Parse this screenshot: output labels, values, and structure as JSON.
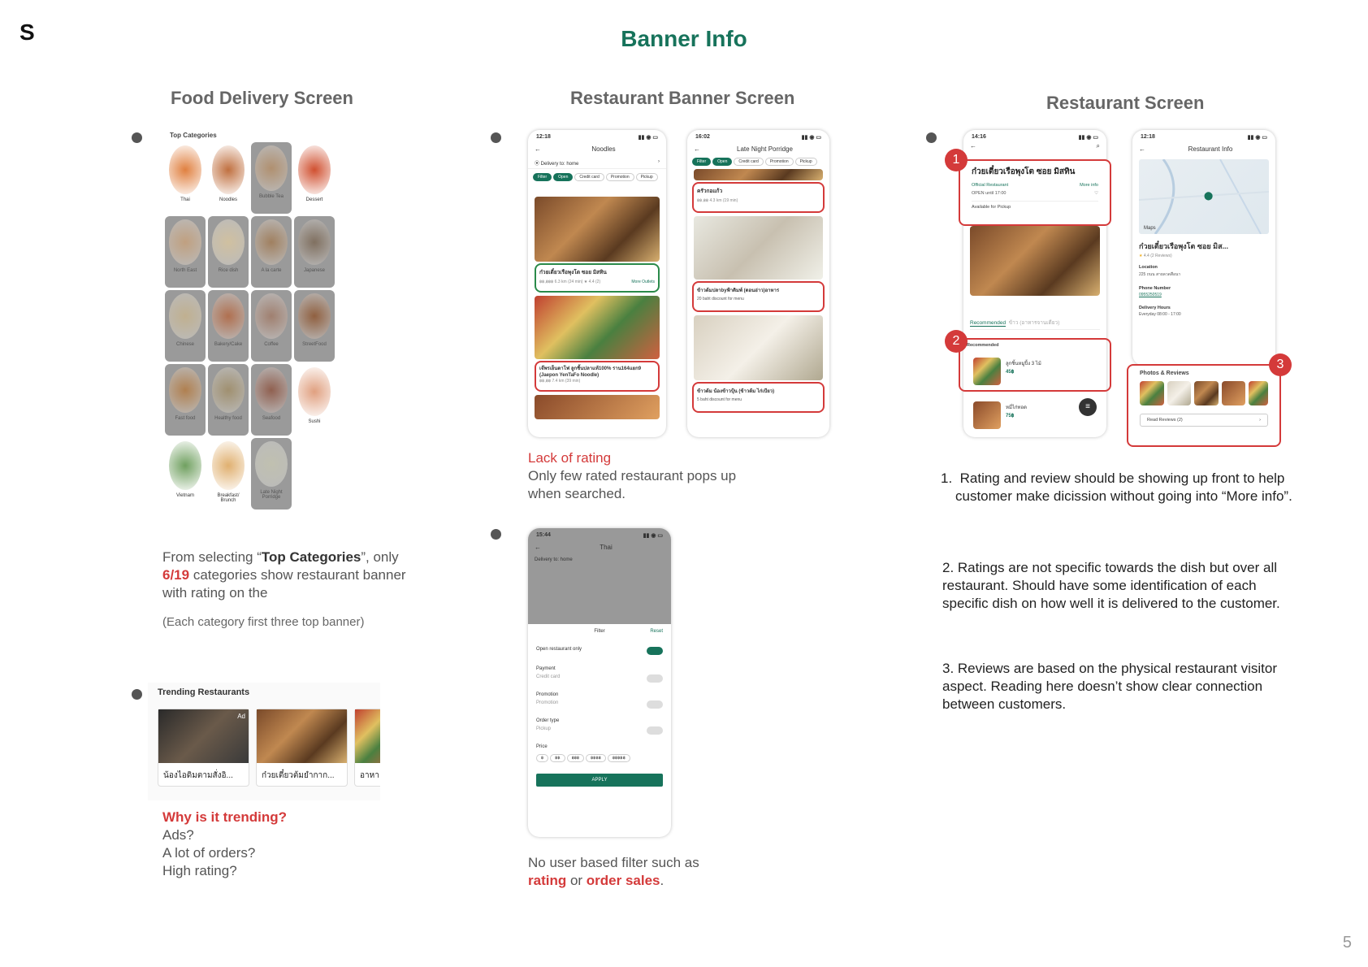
{
  "logo": "S",
  "title": "Banner Info",
  "page_number": "5",
  "sections": {
    "food_delivery": "Food Delivery Screen",
    "restaurant_banner": "Restaurant Banner Screen",
    "restaurant": "Restaurant Screen"
  },
  "top_categories": {
    "heading": "Top Categories",
    "items": [
      "Thai",
      "Noodles",
      "Bubble Tea",
      "Dessert",
      "North East",
      "Rice dish",
      "A la carte",
      "Japanese",
      "Chinese",
      "Bakery/Cake",
      "Coffee",
      "StreetFood",
      "Fast food",
      "Healthy food",
      "Seafood",
      "Sushi",
      "Vietnam",
      "Breakfast/\nBrunch",
      "Late Night\nPorridge"
    ]
  },
  "food_note": {
    "p1_a": "From selecting “",
    "p1_b": "Top Categories",
    "p1_c": "”, only",
    "p1_d": "6/19",
    "p1_e": " categories show restaurant banner with rating on the",
    "p2": "(Each category first three top banner)"
  },
  "trending": {
    "heading": "Trending Restaurants",
    "cards": [
      "น้องไอดิมตามสั่งอิ...",
      "ก๋วยเตี๋ยวต้มยำกาก...",
      "อาหา"
    ],
    "ad": "Ad"
  },
  "trending_note": {
    "q": "Why is it trending?",
    "l1": "Ads?",
    "l2": "A lot of orders?",
    "l3": "High rating?"
  },
  "noodles_phone": {
    "time": "12:18",
    "title": "Noodles",
    "delivery": "Delivery to: home",
    "filters": [
      "Filter",
      "Open",
      "Credit card",
      "Promotion",
      "Pickup"
    ],
    "r1": "ก๋วยเตี๋ยวเรือพุงโต ซอย มิสทิน",
    "r1_meta": "฿฿,฿฿฿  6.3 km (24 min)  ★ 4.4 (2)",
    "r1_more": "More Outlets",
    "r2": "เจ๊พรเย็นตาโฟ ลูกชิ้นปลาแท้100% ราน164แยก9 (Jaepon YenTaFo Noodle)",
    "r2_meta": "฿฿,฿฿  7.4 km (39 min)"
  },
  "porridge_phone": {
    "time": "16:02",
    "title": "Late Night Porridge",
    "r1": "ครัวกอแก้ว",
    "r1_meta": "฿฿,฿฿  4.3 km (19 min)",
    "r2": "ข้าวต้มปลาbyฟ้าดิมพ์ (ดอนอ่าว)อาหาร",
    "r2_promo": "20 baht discount for menu",
    "r3": "ข้าวต้ม น้องข้าวปุ้น (ข้าวต้ม ไก่เบียว)",
    "r3_promo": "5 baht discount for menu"
  },
  "banner_note": {
    "h": "Lack of rating",
    "t": "Only few rated restaurant pops up when searched."
  },
  "thai_phone": {
    "time": "15:44",
    "title": "Thai",
    "delivery": "Delivery to: home",
    "filter": "Filter",
    "reset": "Reset",
    "open_only": "Open restaurant only",
    "payment": "Payment",
    "credit": "Credit card",
    "promotion": "Promotion",
    "promo_opt": "Promotion",
    "order_type": "Order type",
    "pickup": "Pickup",
    "price": "Price",
    "prices": [
      "฿",
      "฿฿",
      "฿฿฿",
      "฿฿฿฿",
      "฿฿฿฿฿"
    ],
    "apply": "APPLY"
  },
  "filter_note": {
    "a": "No user based filter such as ",
    "b": "rating",
    "c": " or ",
    "d": "order sales",
    "e": "."
  },
  "rest_phone": {
    "time": "14:16",
    "name": "ก๋วยเตี๋ยวเรือพุงโต ซอย มิสทิน",
    "official": "Official Restaurant",
    "more": "More info",
    "open": "OPEN until 17:00",
    "pickup": "Available for Pickup",
    "tab1": "Recommended",
    "tab2": "ข้าว (อาหารจานเดียว)",
    "rec": "Recommended",
    "d1": "ลูกชิ้นหมูปิ้ง 3 ไม้",
    "p1": "45฿",
    "d2": "หมี่ไก่ทอด",
    "p2": "75฿"
  },
  "info_phone": {
    "time": "12:18",
    "title": "Restaurant Info",
    "maps": "Maps",
    "name": "ก๋วยเตี๋ยวเรือพุงโต ซอย มิส...",
    "rating": "4.4 (2 Reviews)",
    "loc_h": "Location",
    "loc": "225 ถนน สายลวดสือนา",
    "phone_h": "Phone Number",
    "phone": "0955250519",
    "hours_h": "Delivery Hours",
    "hours": "Everyday  08:00 - 17:00",
    "photos": "Photos & Reviews",
    "read": "Read Reviews (2)"
  },
  "points": [
    "Rating and review should be showing up front to help customer make dicission without going into “More info”.",
    "2.  Ratings are not specific towards the dish but over all restaurant. Should have some identification of each specific dish on how well it is delivered to the customer.",
    "3.  Reviews are based on the physical restaurant visitor aspect. Reading here doesn’t show clear connection between customers."
  ],
  "markers": [
    "1",
    "2",
    "3"
  ]
}
